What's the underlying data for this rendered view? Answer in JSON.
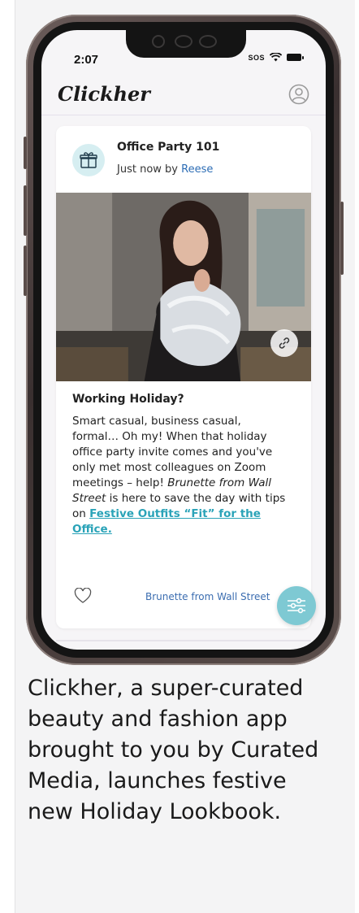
{
  "status_bar": {
    "time": "2:07",
    "carrier": "SOS"
  },
  "app": {
    "logo": "Clickher"
  },
  "post": {
    "title": "Office Party 101",
    "meta_prefix": "Just now by ",
    "author": "Reese",
    "article_heading": "Working Holiday?",
    "body_part1": "Smart casual, business casual, formal… Oh my! When that holiday office party invite comes and you've only met most colleagues on Zoom meetings – help! ",
    "body_emph": "Brunette from Wall Street",
    "body_part2": " is here to save the day with tips on ",
    "body_link": "Festive Outfits “Fit” for the Office.",
    "byline": "Brunette from Wall Street"
  },
  "caption": "Clickher, a super-curated beauty and fashion app brought to you by Curated Media, launches festive new Holiday Lookbook.",
  "colors": {
    "accent_teal": "#7ec9d3",
    "link_teal": "#2aa3b8",
    "author_blue": "#2d6db5"
  },
  "icons": {
    "gift": "gift-icon",
    "profile": "user-circle-icon",
    "link": "link-icon",
    "heart": "heart-icon",
    "filter": "sliders-icon"
  }
}
